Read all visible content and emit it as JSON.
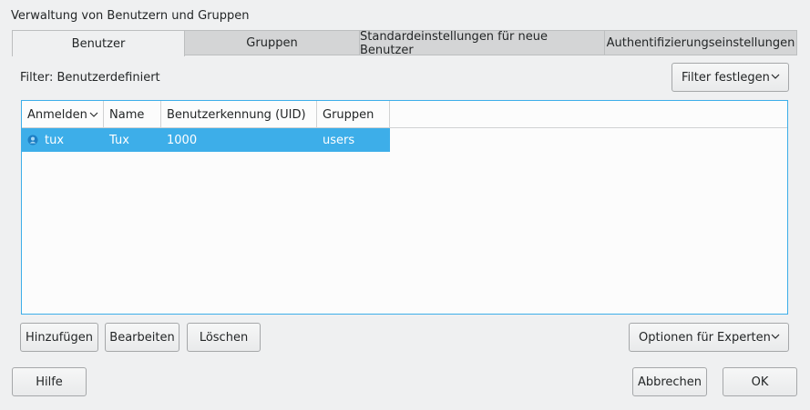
{
  "window": {
    "title": "Verwaltung von Benutzern und Gruppen"
  },
  "tabs": [
    {
      "label": "Benutzer",
      "active": true
    },
    {
      "label": "Gruppen",
      "active": false
    },
    {
      "label": "Standardeinstellungen für neue Benutzer",
      "active": false
    },
    {
      "label": "Authentifizierungseinstellungen",
      "active": false
    }
  ],
  "filter": {
    "label": "Filter: Benutzerdefiniert",
    "button": "Filter festlegen"
  },
  "table": {
    "columns": [
      "Anmelden",
      "Name",
      "Benutzerkennung (UID)",
      "Gruppen"
    ],
    "rows": [
      {
        "login": "tux",
        "name": "Tux",
        "uid": "1000",
        "groups": "users",
        "selected": true
      }
    ]
  },
  "actions": {
    "add": "Hinzufügen",
    "edit": "Bearbeiten",
    "delete": "Löschen",
    "expert": "Optionen für Experten"
  },
  "footer": {
    "help": "Hilfe",
    "cancel": "Abbrechen",
    "ok": "OK"
  },
  "colors": {
    "accent": "#3daee9",
    "background": "#eff0f1",
    "tab_inactive": "#d4d5d6"
  }
}
